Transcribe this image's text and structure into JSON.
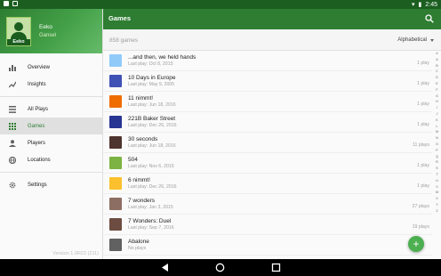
{
  "status_bar": {
    "time": "2:45"
  },
  "drawer": {
    "user_name": "Eeko",
    "user_sub": "Gansel",
    "avatar_caption": "Eeko",
    "items": [
      {
        "label": "Overview",
        "icon": "bar-chart-icon"
      },
      {
        "label": "Insights",
        "icon": "insights-icon"
      },
      {
        "label": "All Plays",
        "icon": "list-icon"
      },
      {
        "label": "Games",
        "icon": "grid-icon"
      },
      {
        "label": "Players",
        "icon": "person-icon"
      },
      {
        "label": "Locations",
        "icon": "globe-icon"
      },
      {
        "label": "Settings",
        "icon": "gear-icon"
      }
    ],
    "version": "Version 1.0R22 (211)"
  },
  "appbar": {
    "title": "Games"
  },
  "subbar": {
    "count": "858 games",
    "sort": "Alphabetical"
  },
  "games": [
    {
      "title": "...and then, we held hands",
      "sub": "Last play: Oct 8, 2015",
      "plays": "1 play",
      "color": "#90caf9"
    },
    {
      "title": "10 Days in Europe",
      "sub": "Last play: May 9, 2005",
      "plays": "1 play",
      "color": "#3f51b5"
    },
    {
      "title": "11 nimmt!",
      "sub": "Last play: Jun 18, 2016",
      "plays": "1 play",
      "color": "#ef6c00"
    },
    {
      "title": "221B Baker Street",
      "sub": "Last play: Dec 26, 2016",
      "plays": "1 play",
      "color": "#283593"
    },
    {
      "title": "30 seconds",
      "sub": "Last play: Jun 18, 2016",
      "plays": "11 plays",
      "color": "#4e342e"
    },
    {
      "title": "504",
      "sub": "Last play: Nov 6, 2015",
      "plays": "1 play",
      "color": "#7cb342"
    },
    {
      "title": "6 nimmt!",
      "sub": "Last play: Dec 26, 2016",
      "plays": "1 play",
      "color": "#fbc02d"
    },
    {
      "title": "7 wonders",
      "sub": "Last play: Jan 3, 2015",
      "plays": "27 plays",
      "color": "#8d6e63"
    },
    {
      "title": "7 Wonders: Duel",
      "sub": "Last play: Sep 7, 2016",
      "plays": "19 plays",
      "color": "#6d4c41"
    },
    {
      "title": "Abalone",
      "sub": "No plays",
      "plays": "",
      "color": "#616161"
    }
  ],
  "alphabet": [
    "#",
    "A",
    "B",
    "C",
    "D",
    "E",
    "F",
    "G",
    "H",
    "I",
    "J",
    "K",
    "L",
    "M",
    "N",
    "O",
    "P",
    "Q",
    "R",
    "S",
    "T",
    "U",
    "V",
    "W",
    "X",
    "Y",
    "Z"
  ],
  "fab": {
    "label": "+"
  }
}
